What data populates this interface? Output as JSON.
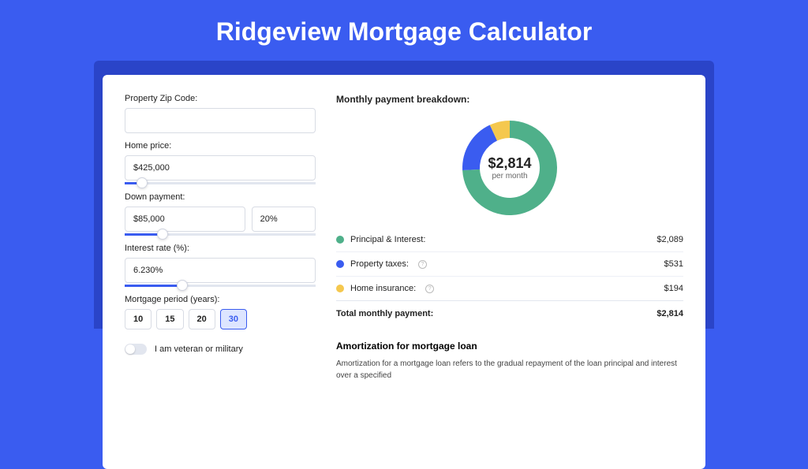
{
  "title": "Ridgeview Mortgage Calculator",
  "left": {
    "zip_label": "Property Zip Code:",
    "zip_value": "",
    "home_price_label": "Home price:",
    "home_price_value": "$425,000",
    "home_price_slider_pct": 9,
    "down_label": "Down payment:",
    "down_amount": "$85,000",
    "down_pct": "20%",
    "down_slider_pct": 20,
    "rate_label": "Interest rate (%):",
    "rate_value": "6.230%",
    "rate_slider_pct": 30,
    "period_label": "Mortgage period (years):",
    "periods": [
      "10",
      "15",
      "20",
      "30"
    ],
    "period_active_index": 3,
    "veteran_label": "I am veteran or military",
    "veteran_on": false
  },
  "right": {
    "breakdown_title": "Monthly payment breakdown:",
    "donut": {
      "center_amount": "$2,814",
      "center_sub": "per month",
      "segments": [
        {
          "color": "#4fb08a",
          "pct": 74.2
        },
        {
          "color": "#3a5cf0",
          "pct": 18.9
        },
        {
          "color": "#f5c84e",
          "pct": 6.9
        }
      ]
    },
    "items": [
      {
        "dot": "green",
        "label": "Principal & Interest:",
        "info": false,
        "value": "$2,089"
      },
      {
        "dot": "blue",
        "label": "Property taxes:",
        "info": true,
        "value": "$531"
      },
      {
        "dot": "yellow",
        "label": "Home insurance:",
        "info": true,
        "value": "$194"
      }
    ],
    "total_label": "Total monthly payment:",
    "total_value": "$2,814",
    "amort_title": "Amortization for mortgage loan",
    "amort_text": "Amortization for a mortgage loan refers to the gradual repayment of the loan principal and interest over a specified"
  },
  "chart_data": {
    "type": "pie",
    "title": "Monthly payment breakdown",
    "series": [
      {
        "name": "Principal & Interest",
        "value": 2089,
        "color": "#4fb08a"
      },
      {
        "name": "Property taxes",
        "value": 531,
        "color": "#3a5cf0"
      },
      {
        "name": "Home insurance",
        "value": 194,
        "color": "#f5c84e"
      }
    ],
    "total": 2814,
    "center_label": "$2,814 per month"
  }
}
